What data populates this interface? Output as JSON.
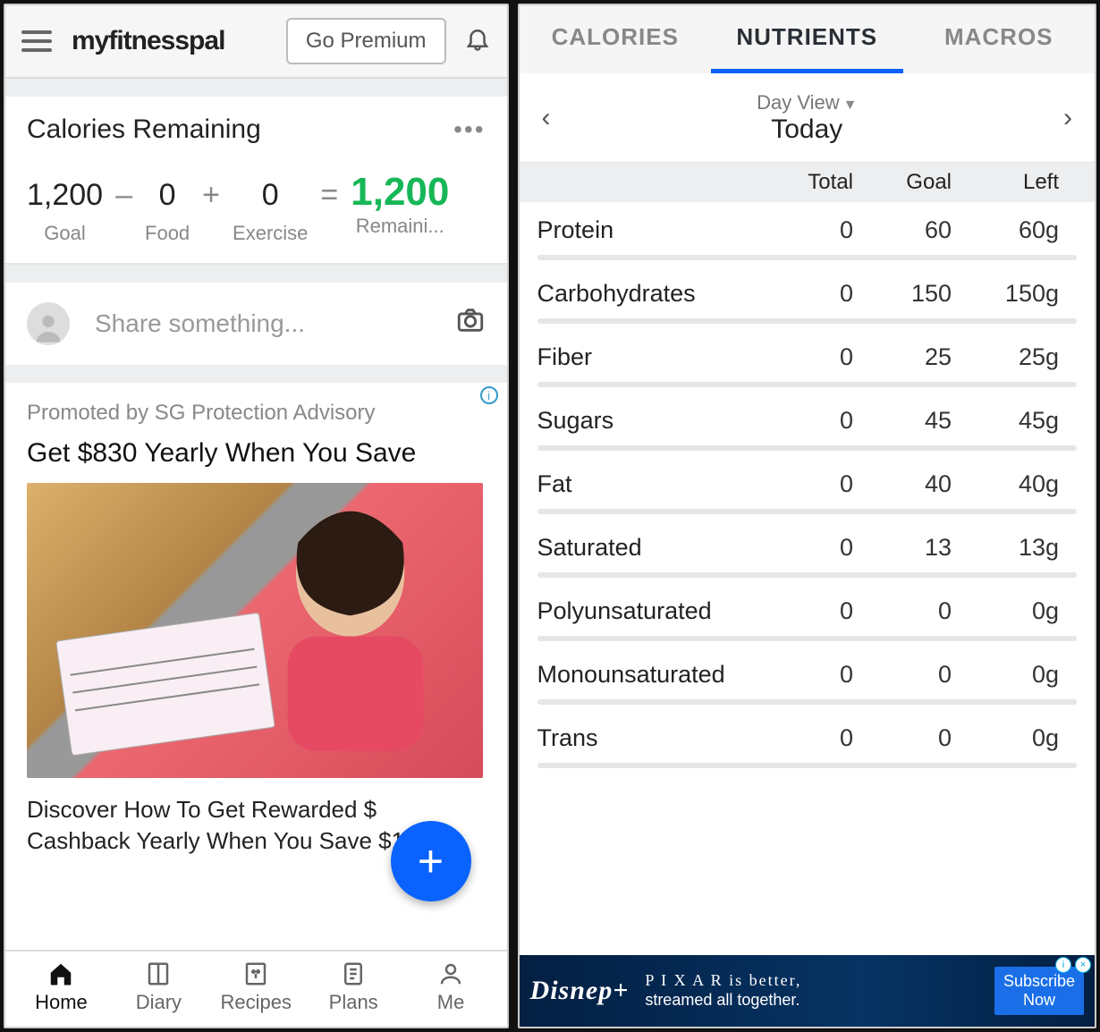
{
  "left": {
    "header": {
      "title": "myfitnesspal",
      "premium_btn": "Go Premium"
    },
    "calories": {
      "title": "Calories Remaining",
      "goal_val": "1,200",
      "goal_lab": "Goal",
      "food_val": "0",
      "food_lab": "Food",
      "ex_val": "0",
      "ex_lab": "Exercise",
      "res_val": "1,200",
      "res_lab": "Remaini..."
    },
    "share": {
      "placeholder": "Share something..."
    },
    "promo": {
      "by": "Promoted by SG Protection Advisory",
      "title": "Get $830 Yearly When You Save",
      "body": "Discover How To Get Rewarded $ Cashback Yearly When You Save $170/"
    },
    "nav": {
      "home": "Home",
      "diary": "Diary",
      "recipes": "Recipes",
      "plans": "Plans",
      "me": "Me"
    }
  },
  "right": {
    "tabs": {
      "calories": "CALORIES",
      "nutrients": "NUTRIENTS",
      "macros": "MACROS"
    },
    "date": {
      "view": "Day View",
      "day": "Today"
    },
    "headers": {
      "total": "Total",
      "goal": "Goal",
      "left": "Left"
    },
    "rows": [
      {
        "name": "Protein",
        "total": "0",
        "goal": "60",
        "left": "60g"
      },
      {
        "name": "Carbohydrates",
        "total": "0",
        "goal": "150",
        "left": "150g"
      },
      {
        "name": "Fiber",
        "total": "0",
        "goal": "25",
        "left": "25g"
      },
      {
        "name": "Sugars",
        "total": "0",
        "goal": "45",
        "left": "45g"
      },
      {
        "name": "Fat",
        "total": "0",
        "goal": "40",
        "left": "40g"
      },
      {
        "name": "Saturated",
        "total": "0",
        "goal": "13",
        "left": "13g"
      },
      {
        "name": "Polyunsaturated",
        "total": "0",
        "goal": "0",
        "left": "0g"
      },
      {
        "name": "Monounsaturated",
        "total": "0",
        "goal": "0",
        "left": "0g"
      },
      {
        "name": "Trans",
        "total": "0",
        "goal": "0",
        "left": "0g"
      }
    ],
    "ad": {
      "brand": "Disnep+",
      "line1": "P I X A R is better,",
      "line2": "streamed all together.",
      "cta1": "Subscribe",
      "cta2": "Now"
    }
  }
}
